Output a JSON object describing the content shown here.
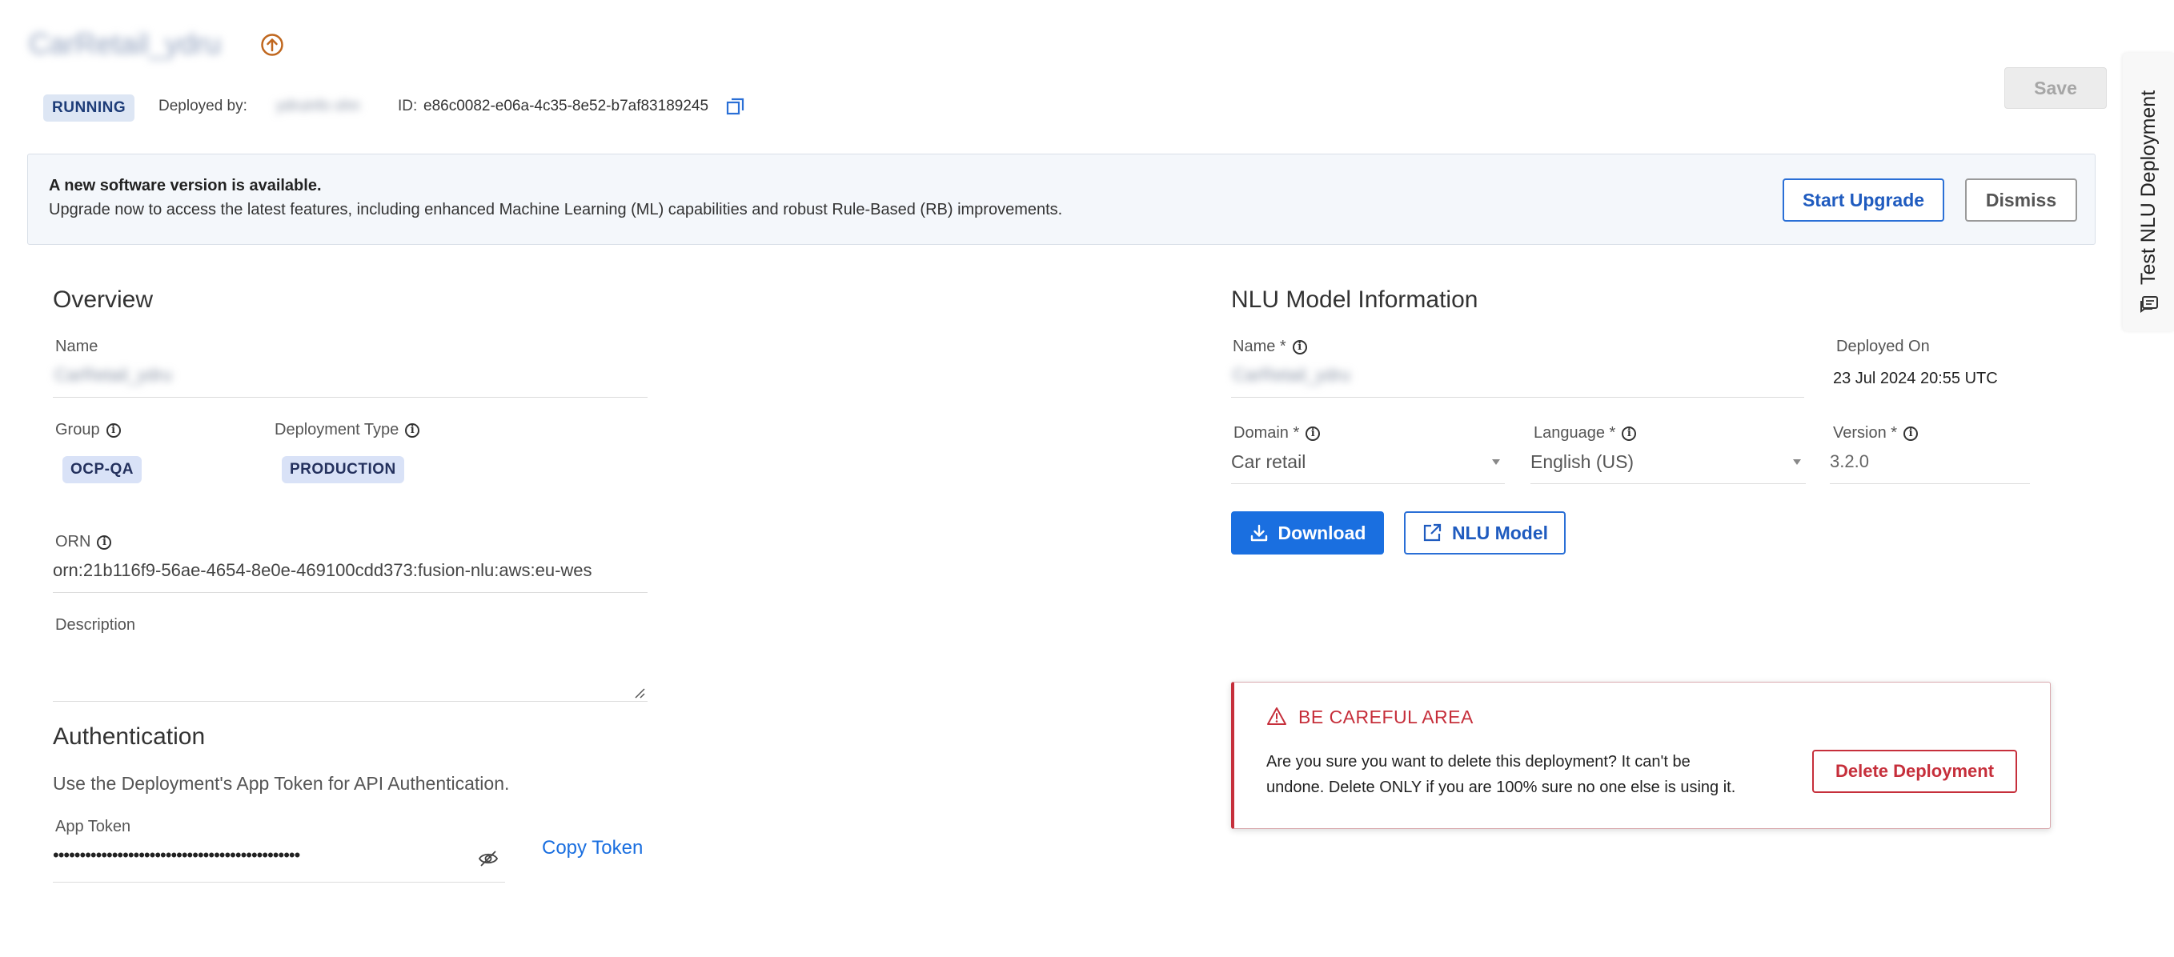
{
  "header": {
    "deployment_name": "CarRetail_ydru",
    "status": "RUNNING",
    "deployed_by_label": "Deployed by:",
    "deployed_by_value": "ydruinfo ohn",
    "id_label": "ID:",
    "id_value": "e86c0082-e06a-4c35-8e52-b7af83189245",
    "save_label": "Save"
  },
  "banner": {
    "title": "A new software version is available.",
    "message": "Upgrade now to access the latest features, including enhanced Machine Learning (ML) capabilities and robust Rule-Based (RB) improvements.",
    "upgrade_label": "Start Upgrade",
    "dismiss_label": "Dismiss"
  },
  "overview": {
    "title": "Overview",
    "name_label": "Name",
    "name_value": "CarRetail_ydru",
    "group_label": "Group",
    "group_value": "OCP-QA",
    "deployment_type_label": "Deployment Type",
    "deployment_type_value": "PRODUCTION",
    "orn_label": "ORN",
    "orn_value": "orn:21b116f9-56ae-4654-8e0e-469100cdd373:fusion-nlu:aws:eu-wes",
    "description_label": "Description",
    "description_value": ""
  },
  "auth": {
    "title": "Authentication",
    "subtitle": "Use the Deployment's App Token for API Authentication.",
    "token_label": "App Token",
    "token_value": "••••••••••••••••••••••••••••••••••••••••••••••",
    "copy_label": "Copy Token"
  },
  "nlu": {
    "title": "NLU Model Information",
    "name_label": "Name *",
    "name_value": "CarRetail_ydru",
    "deployed_on_label": "Deployed On",
    "deployed_on_value": "23 Jul 2024 20:55 UTC",
    "domain_label": "Domain *",
    "domain_value": "Car retail",
    "language_label": "Language *",
    "language_value": "English (US)",
    "version_label": "Version *",
    "version_value": "3.2.0",
    "download_label": "Download",
    "nlu_model_label": "NLU Model"
  },
  "danger": {
    "title": "BE CAREFUL AREA",
    "message_line1": "Are you sure you want to delete this deployment? It can't be",
    "message_line2": "undone. Delete ONLY if you are 100% sure no one else is using it.",
    "delete_label": "Delete Deployment"
  },
  "side_tab": {
    "label": "Test NLU Deployment"
  },
  "colors": {
    "primary": "#1a73e8",
    "danger": "#c62f3b",
    "chip_bg": "#d9e2f7",
    "banner_bg": "#f4f7fb"
  }
}
